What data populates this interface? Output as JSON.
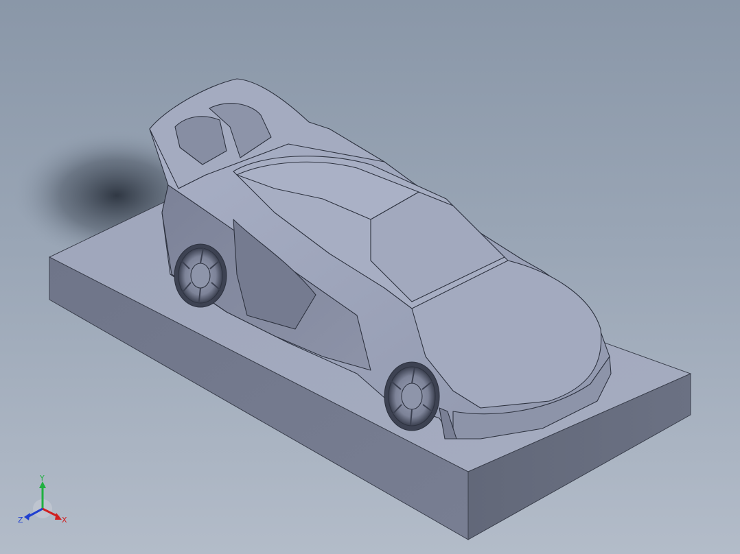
{
  "viewport": {
    "background_top": "#8a97a8",
    "background_bottom": "#b3bcc9",
    "model_color": "#9ba2b8"
  },
  "triad": {
    "x_label": "X",
    "y_label": "Y",
    "z_label": "Z",
    "x_color": "#d02020",
    "y_color": "#20b040",
    "z_color": "#2040d0"
  }
}
